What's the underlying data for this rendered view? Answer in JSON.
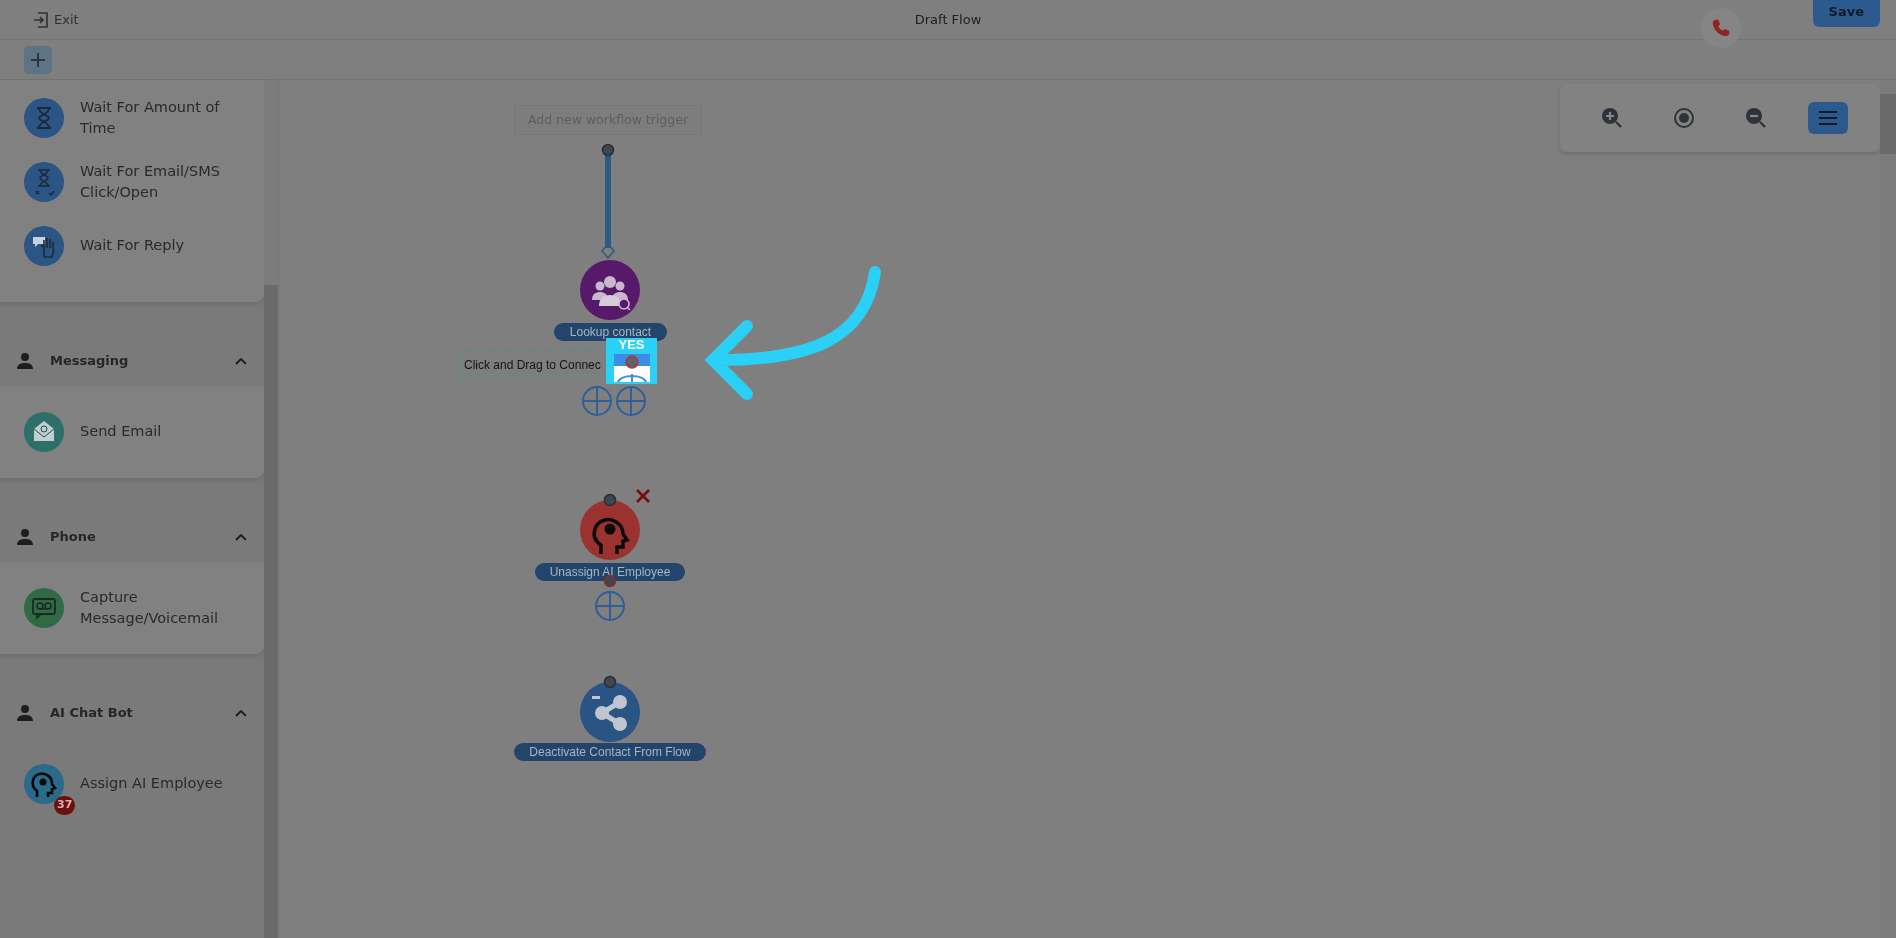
{
  "header": {
    "exit_label": "Exit",
    "title": "Draft Flow",
    "save_label": "Save"
  },
  "sidebar": {
    "sections": [
      {
        "items": [
          {
            "label": "Wait For Amount of Time",
            "kind": "hourglass",
            "color": "#2b5584"
          },
          {
            "label": "Wait For Email/SMS Click/Open",
            "kind": "hourglass-split",
            "color": "#2b5584"
          },
          {
            "label": "Wait For Reply",
            "kind": "hand",
            "color": "#2b5584"
          }
        ]
      },
      {
        "title": "Messaging",
        "expanded": true,
        "items": [
          {
            "label": "Send Email",
            "kind": "email",
            "color": "#2f6f6a"
          }
        ]
      },
      {
        "title": "Phone",
        "expanded": true,
        "items": [
          {
            "label": "Capture Message/Voicemail",
            "kind": "voicemail",
            "color": "#2f6a45"
          }
        ]
      },
      {
        "title": "AI Chat Bot",
        "expanded": true,
        "items": [
          {
            "label": "Assign AI Employee",
            "kind": "ai",
            "color": "#2a6a8a",
            "badge": "37"
          }
        ]
      }
    ]
  },
  "canvas": {
    "trigger_placeholder": "Add new workflow trigger",
    "nodes": [
      {
        "kind": "lookup",
        "label": "Lookup contact",
        "color": "#57196a",
        "removable": false
      },
      {
        "kind": "ai",
        "label": "Unassign AI Employee",
        "color": "#9a322f",
        "removable": true
      },
      {
        "kind": "share",
        "label": "Deactivate Contact From Flow",
        "color": "#2a5484",
        "removable": false
      }
    ],
    "connect_tooltip": "Click and Drag to Connec",
    "branch_label": "YES"
  },
  "zoom_toolbar": [
    {
      "kind": "zoom-in",
      "active": false
    },
    {
      "kind": "center",
      "active": false
    },
    {
      "kind": "zoom-out",
      "active": false
    },
    {
      "kind": "menu",
      "active": true
    }
  ]
}
